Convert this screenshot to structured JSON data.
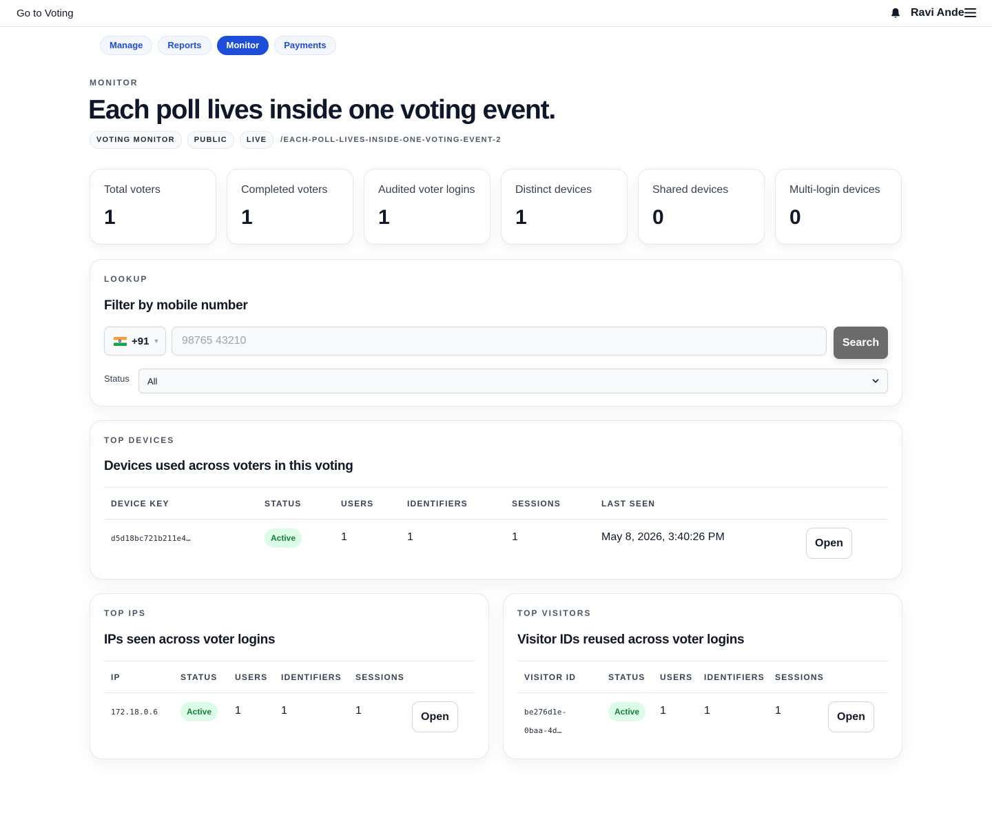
{
  "topbar": {
    "back_label": "Go to Voting",
    "user_name": "Ravi Ande"
  },
  "tabs": [
    {
      "label": "Manage",
      "active": false
    },
    {
      "label": "Reports",
      "active": false
    },
    {
      "label": "Monitor",
      "active": true
    },
    {
      "label": "Payments",
      "active": false
    }
  ],
  "page": {
    "eyebrow": "MONITOR",
    "title": "Each poll lives inside one voting event.",
    "tags": [
      "VOTING MONITOR",
      "PUBLIC",
      "LIVE"
    ],
    "slug": "/EACH-POLL-LIVES-INSIDE-ONE-VOTING-EVENT-2"
  },
  "stats": [
    {
      "label": "Total voters",
      "value": "1"
    },
    {
      "label": "Completed voters",
      "value": "1"
    },
    {
      "label": "Audited voter logins",
      "value": "1"
    },
    {
      "label": "Distinct devices",
      "value": "1"
    },
    {
      "label": "Shared devices",
      "value": "0"
    },
    {
      "label": "Multi-login devices",
      "value": "0"
    }
  ],
  "lookup": {
    "eyebrow": "LOOKUP",
    "title": "Filter by mobile number",
    "country_code": "+91",
    "phone_placeholder": "98765 43210",
    "phone_value": "",
    "search_label": "Search",
    "status_label": "Status",
    "status_value": "All"
  },
  "devices": {
    "eyebrow": "TOP DEVICES",
    "title": "Devices used across voters in this voting",
    "columns": [
      "DEVICE KEY",
      "STATUS",
      "USERS",
      "IDENTIFIERS",
      "SESSIONS",
      "LAST SEEN"
    ],
    "rows": [
      {
        "key": "d5d18bc721b211e4…",
        "status": "Active",
        "users": "1",
        "identifiers": "1",
        "sessions": "1",
        "last_seen": "May 8, 2026, 3:40:26 PM",
        "action": "Open"
      }
    ]
  },
  "ips": {
    "eyebrow": "TOP IPS",
    "title": "IPs seen across voter logins",
    "columns": [
      "IP",
      "STATUS",
      "USERS",
      "IDENTIFIERS",
      "SESSIONS"
    ],
    "rows": [
      {
        "ip": "172.18.0.6",
        "status": "Active",
        "users": "1",
        "identifiers": "1",
        "sessions": "1",
        "action": "Open"
      }
    ]
  },
  "visitors": {
    "eyebrow": "TOP VISITORS",
    "title": "Visitor IDs reused across voter logins",
    "columns": [
      "VISITOR ID",
      "STATUS",
      "USERS",
      "IDENTIFIERS",
      "SESSIONS"
    ],
    "rows": [
      {
        "visitor_line1": "be276d1e-",
        "visitor_line2": "0baa-4d…",
        "status": "Active",
        "users": "1",
        "identifiers": "1",
        "sessions": "1",
        "action": "Open"
      }
    ]
  },
  "colors": {
    "accent": "#1d4ed8",
    "active_badge_bg": "#dcfce7",
    "active_badge_text": "#15803d",
    "search_button": "#6b6b6b"
  },
  "icons": {
    "notifications": "bell-icon",
    "menu": "hamburger-menu-icon",
    "country_flag": "india-flag-icon",
    "select": "chevron-down-icon"
  }
}
